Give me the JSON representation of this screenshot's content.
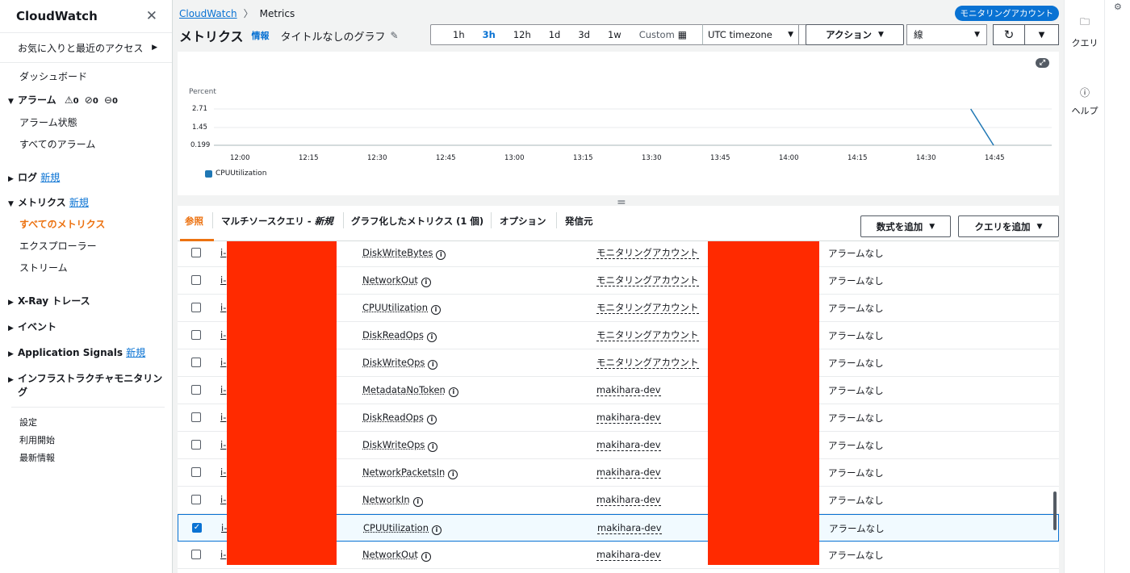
{
  "sidebar": {
    "title": "CloudWatch",
    "favorites": "お気に入りと最近のアクセス",
    "dashboard": "ダッシュボード",
    "alarms": {
      "label": "アラーム",
      "warn": "0",
      "ok": "0",
      "insufficient": "0"
    },
    "alarm_state": "アラーム状態",
    "all_alarms": "すべてのアラーム",
    "logs": "ログ",
    "new": "新規",
    "metrics": "メトリクス",
    "all_metrics": "すべてのメトリクス",
    "explorer": "エクスプローラー",
    "streams": "ストリーム",
    "xray": "X-Ray トレース",
    "events": "イベント",
    "app_signals": "Application Signals",
    "infra_line1": "インフラストラクチャモニタリン",
    "infra_line2": "グ",
    "settings": "設定",
    "getting_started": "利用開始",
    "whats_new": "最新情報"
  },
  "breadcrumb": {
    "root": "CloudWatch",
    "current": "Metrics"
  },
  "monitoring_badge": "モニタリングアカウント",
  "header": {
    "title": "メトリクス",
    "info": "情報",
    "graph_title": "タイトルなしのグラフ"
  },
  "time_ranges": [
    "1h",
    "3h",
    "12h",
    "1d",
    "3d",
    "1w"
  ],
  "time_selected": "3h",
  "custom": "Custom",
  "timezone": "UTC timezone",
  "actions": "アクション",
  "graph_type": "線",
  "tabs": {
    "browse": "参照",
    "multi_source": "マルチソースクエリ - ",
    "multi_source_new": "新規",
    "graphed": "グラフ化したメトリクス (1 個)",
    "options": "オプション",
    "source": "発信元"
  },
  "add_math": "数式を追加",
  "add_query": "クエリを追加",
  "rail": {
    "query": "クエリ",
    "help": "ヘルプ"
  },
  "colors": {
    "accent": "#ec7211",
    "link": "#0972d3",
    "series": "#1f77b4",
    "redaction": "#ff2a00"
  },
  "chart_data": {
    "type": "line",
    "ylabel": "Percent",
    "yticks": [
      "2.71",
      "1.45",
      "0.199"
    ],
    "ylim": [
      0.199,
      2.71
    ],
    "xticks": [
      "12:00",
      "12:15",
      "12:30",
      "12:45",
      "13:00",
      "13:15",
      "13:30",
      "13:45",
      "14:00",
      "14:15",
      "14:30",
      "14:45"
    ],
    "legend": "top-left",
    "series": [
      {
        "name": "CPUUtilization",
        "x": [
          "14:40",
          "14:45"
        ],
        "values": [
          2.71,
          0.199
        ]
      }
    ]
  },
  "rows": [
    {
      "instance": "i-",
      "metric": "DiskWriteBytes",
      "account": "モニタリングアカウント",
      "alarm": "アラームなし",
      "checked": false
    },
    {
      "instance": "i-",
      "metric": "NetworkOut",
      "account": "モニタリングアカウント",
      "alarm": "アラームなし",
      "checked": false
    },
    {
      "instance": "i-",
      "metric": "CPUUtilization",
      "account": "モニタリングアカウント",
      "alarm": "アラームなし",
      "checked": false
    },
    {
      "instance": "i-",
      "metric": "DiskReadOps",
      "account": "モニタリングアカウント",
      "alarm": "アラームなし",
      "checked": false
    },
    {
      "instance": "i-",
      "metric": "DiskWriteOps",
      "account": "モニタリングアカウント",
      "alarm": "アラームなし",
      "checked": false
    },
    {
      "instance": "i-",
      "metric": "MetadataNoToken",
      "account": "makihara-dev",
      "alarm": "アラームなし",
      "checked": false
    },
    {
      "instance": "i-",
      "metric": "DiskReadOps",
      "account": "makihara-dev",
      "alarm": "アラームなし",
      "checked": false
    },
    {
      "instance": "i-",
      "metric": "DiskWriteOps",
      "account": "makihara-dev",
      "alarm": "アラームなし",
      "checked": false
    },
    {
      "instance": "i-",
      "metric": "NetworkPacketsIn",
      "account": "makihara-dev",
      "alarm": "アラームなし",
      "checked": false
    },
    {
      "instance": "i-",
      "metric": "NetworkIn",
      "account": "makihara-dev",
      "alarm": "アラームなし",
      "checked": false
    },
    {
      "instance": "i-",
      "metric": "CPUUtilization",
      "account": "makihara-dev",
      "alarm": "アラームなし",
      "checked": true
    },
    {
      "instance": "i-",
      "metric": "NetworkOut",
      "account": "makihara-dev",
      "alarm": "アラームなし",
      "checked": false
    }
  ]
}
